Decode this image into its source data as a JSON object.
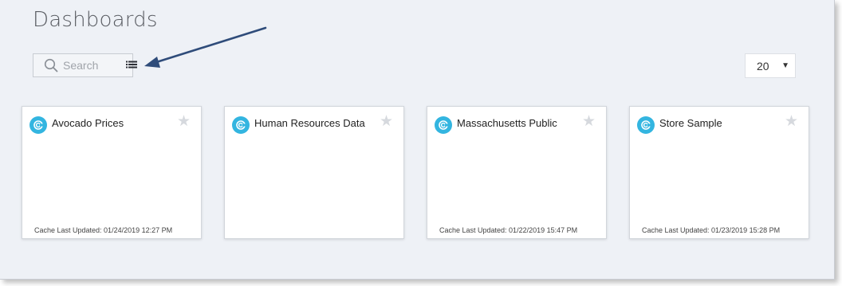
{
  "header": {
    "title": "Dashboards"
  },
  "toolbar": {
    "search_placeholder": "Search",
    "page_size": "20"
  },
  "cards": [
    {
      "title": "Avocado Prices",
      "cache": "Cache Last Updated: 01/24/2019 12:27 PM"
    },
    {
      "title": "Human Resources Data",
      "cache": ""
    },
    {
      "title": "Massachusetts Public",
      "cache": "Cache Last Updated: 01/22/2019 15:47 PM"
    },
    {
      "title": "Store Sample",
      "cache": "Cache Last Updated: 01/23/2019 15:28 PM"
    }
  ],
  "icons": {
    "search": "search-icon",
    "list_view": "list-view-icon",
    "favorite": "star-icon",
    "dashboard_logo": "dashboard-logo-icon",
    "annotation": "arrow-annotation"
  },
  "colors": {
    "background": "#eef1f6",
    "logo": "#33b5e0",
    "arrow": "#2f4c7a",
    "star": "#d6d9de"
  }
}
